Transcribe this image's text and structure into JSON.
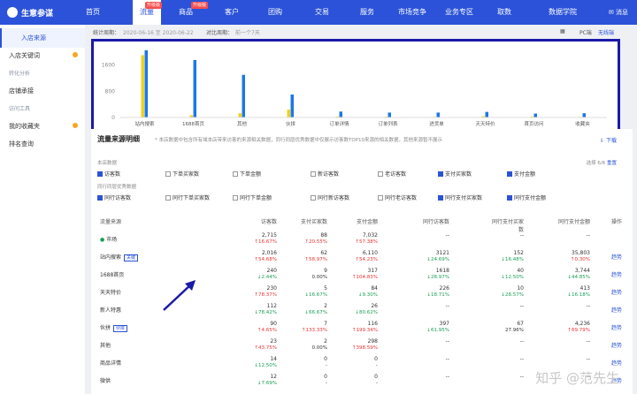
{
  "nav": {
    "brand": "生意参谋",
    "items": [
      "首页",
      "流量",
      "商品",
      "客户",
      "团购",
      "交易",
      "服务",
      "市场竞争",
      "业务专区",
      "取数",
      "数据学院"
    ],
    "badges": {
      "1": "升级版",
      "2": "升级版"
    },
    "active": 1,
    "message": "消息"
  },
  "sidebar": {
    "items": [
      "入店来源",
      "入店关键词",
      "店铺承接",
      "我的收藏夹",
      "排名查询"
    ],
    "groups": [
      "转化分析",
      "访问工具"
    ]
  },
  "filter": {
    "label": "统计周期：",
    "date": "2020-06-16 至 2020-06-22",
    "compare_label": "对比周期：",
    "compare": "前一个7天",
    "pc": "PC端",
    "wireless": "无线端"
  },
  "chart_data": {
    "type": "bar",
    "categories": [
      "站内搜索",
      "1688首页",
      "其他",
      "伙拼",
      "订单详情",
      "订单列表",
      "进货单",
      "天天特价",
      "首页访问",
      "收藏夹"
    ],
    "series": [
      {
        "name": "",
        "values": [
          1900,
          70,
          130,
          240,
          30,
          25,
          20,
          40,
          30,
          20
        ]
      },
      {
        "name": "",
        "values": [
          2050,
          1750,
          1300,
          700,
          180,
          150,
          150,
          170,
          120,
          130
        ]
      }
    ],
    "ytick_labels": [
      "0",
      "800",
      "1600"
    ],
    "ylim": [
      0,
      2100
    ],
    "colors": [
      "#f0d01a",
      "#1e77e5"
    ]
  },
  "detail": {
    "title": "流量来源明细",
    "note": "* 本店数据中包含所有域本店带来访客的来源相关数据，同行同层优秀数据中仅展示访客数TOP10来源的相关数据，其他来源暂不展示",
    "download": "下载",
    "group1": "本店数据",
    "group2": "同行同层优秀数据",
    "selected_count": "选择 6/6",
    "reset": "重置",
    "checks1": [
      {
        "label": "访客数",
        "on": true
      },
      {
        "label": "下单买家数",
        "on": false
      },
      {
        "label": "下单金额",
        "on": false
      },
      {
        "label": "新访客数",
        "on": false
      },
      {
        "label": "老访客数",
        "on": false
      },
      {
        "label": "支付买家数",
        "on": true
      },
      {
        "label": "支付金额",
        "on": true
      }
    ],
    "checks2": [
      {
        "label": "同行访客数",
        "on": true
      },
      {
        "label": "同行下单买家数",
        "on": false
      },
      {
        "label": "同行下单金额",
        "on": false
      },
      {
        "label": "同行新访客数",
        "on": false
      },
      {
        "label": "同行老访客数",
        "on": false
      },
      {
        "label": "同行支付买家数",
        "on": true
      },
      {
        "label": "同行支付金额",
        "on": true
      }
    ],
    "headers": [
      "流量来源",
      "访客数",
      "支付买家数",
      "支付金额",
      "同行访客数",
      "同行支付买家数",
      "同行支付金额",
      "操作"
    ],
    "rows": [
      {
        "name": "市场",
        "tag": "",
        "v": [
          "2,715",
          "88",
          "7,032",
          "--",
          "--",
          "--"
        ],
        "p": [
          "↑16.67%",
          "↑20.55%",
          "↑57.38%",
          "",
          "",
          ""
        ],
        "trend": ""
      },
      {
        "name": "站内搜索",
        "tag": "关键",
        "v": [
          "2,016",
          "62",
          "6,110",
          "3121",
          "152",
          "35,803"
        ],
        "p": [
          "↑54.68%",
          "↑58.97%",
          "↑54.23%",
          "↓24.69%",
          "↓16.48%",
          "↑0.30%"
        ],
        "trend": "趋势"
      },
      {
        "name": "1688首页",
        "tag": "",
        "v": [
          "240",
          "9",
          "317",
          "1618",
          "40",
          "3,744"
        ],
        "p": [
          "↓2.44%",
          "0.00%",
          "↑104.83%",
          "↓28.97%",
          "↓12.50%",
          "↓44.85%"
        ],
        "trend": "趋势"
      },
      {
        "name": "天天特价",
        "tag": "",
        "v": [
          "230",
          "5",
          "84",
          "226",
          "10",
          "413"
        ],
        "p": [
          "↑78.37%",
          "↓16.67%",
          "↓9.30%",
          "↓18.71%",
          "↓28.57%",
          "↓16.18%"
        ],
        "trend": "趋势"
      },
      {
        "name": "新人特惠",
        "tag": "",
        "v": [
          "112",
          "2",
          "26",
          "--",
          "--",
          "--"
        ],
        "p": [
          "↓78.42%",
          "↓66.67%",
          "↓80.62%",
          "",
          "",
          ""
        ],
        "trend": "趋势"
      },
      {
        "name": "伙拼",
        "tag": "伙拼",
        "v": [
          "90",
          "7",
          "116",
          "397",
          "67",
          "4,236"
        ],
        "p": [
          "↑4.65%",
          "↑133.33%",
          "↑199.34%",
          "↓61.95%",
          "27.96%",
          "↑69.79%"
        ],
        "trend": "趋势"
      },
      {
        "name": "其他",
        "tag": "",
        "v": [
          "23",
          "2",
          "298",
          "--",
          "--",
          "--"
        ],
        "p": [
          "↑43.75%",
          "0.00%",
          "↑398.59%",
          "",
          "",
          ""
        ],
        "trend": "趋势"
      },
      {
        "name": "商品详情",
        "tag": "",
        "v": [
          "14",
          "0",
          "0",
          "--",
          "--",
          "--"
        ],
        "p": [
          "↓12.50%",
          "-",
          "-",
          "",
          "",
          ""
        ],
        "trend": "趋势"
      },
      {
        "name": "微供",
        "tag": "",
        "v": [
          "12",
          "0",
          "0",
          "--",
          "--",
          "--"
        ],
        "p": [
          "↓7.69%",
          "-",
          "-",
          "",
          "",
          ""
        ],
        "trend": "趋势"
      }
    ]
  },
  "watermark": "知乎 @范先生"
}
